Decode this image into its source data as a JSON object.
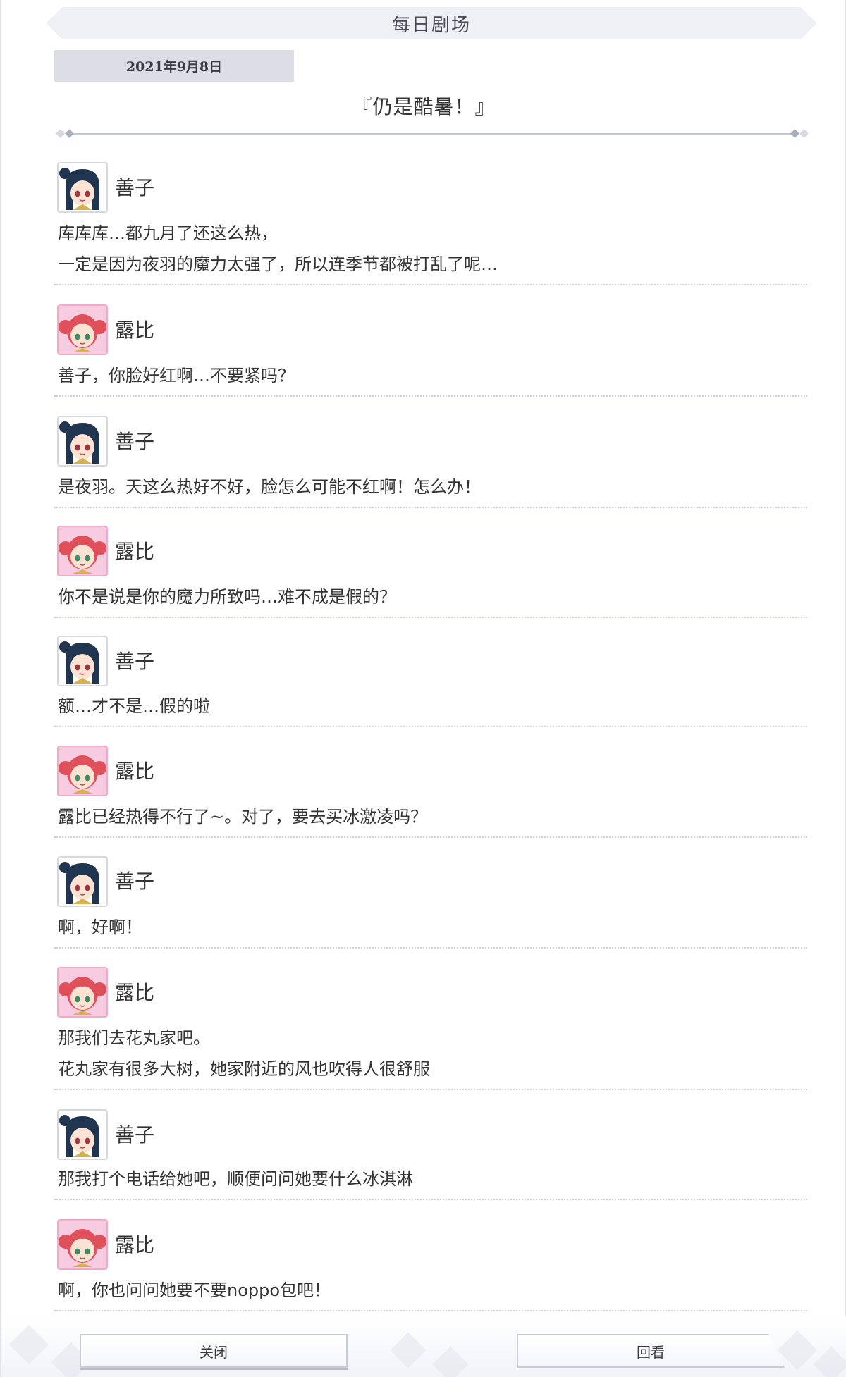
{
  "header": {
    "title": "每日剧场"
  },
  "episode": {
    "date": "2021年9月8日",
    "title": "『仍是酷暑！』"
  },
  "dialogue": [
    {
      "speaker": "善子",
      "avatar": "yoshiko-avatar",
      "lines": [
        "库库库…都九月了还这么热，",
        "一定是因为夜羽的魔力太强了，所以连季节都被打乱了呢…"
      ]
    },
    {
      "speaker": "露比",
      "avatar": "ruby-avatar",
      "lines": [
        "善子，你脸好红啊…不要紧吗？"
      ]
    },
    {
      "speaker": "善子",
      "avatar": "yoshiko-avatar",
      "lines": [
        "是夜羽。天这么热好不好，脸怎么可能不红啊！怎么办！"
      ]
    },
    {
      "speaker": "露比",
      "avatar": "ruby-avatar",
      "lines": [
        "你不是说是你的魔力所致吗…难不成是假的？"
      ]
    },
    {
      "speaker": "善子",
      "avatar": "yoshiko-avatar",
      "lines": [
        "额…才不是…假的啦"
      ]
    },
    {
      "speaker": "露比",
      "avatar": "ruby-avatar",
      "lines": [
        "露比已经热得不行了~。对了，要去买冰激凌吗？"
      ]
    },
    {
      "speaker": "善子",
      "avatar": "yoshiko-avatar",
      "lines": [
        "啊，好啊！"
      ]
    },
    {
      "speaker": "露比",
      "avatar": "ruby-avatar",
      "lines": [
        "那我们去花丸家吧。",
        "花丸家有很多大树，她家附近的风也吹得人很舒服"
      ]
    },
    {
      "speaker": "善子",
      "avatar": "yoshiko-avatar",
      "lines": [
        "那我打个电话给她吧，顺便问问她要什么冰淇淋"
      ]
    },
    {
      "speaker": "露比",
      "avatar": "ruby-avatar",
      "lines": [
        "啊，你也问问她要不要noppo包吧！"
      ]
    }
  ],
  "buttons": {
    "close_label": "关闭",
    "review_label": "回看"
  }
}
